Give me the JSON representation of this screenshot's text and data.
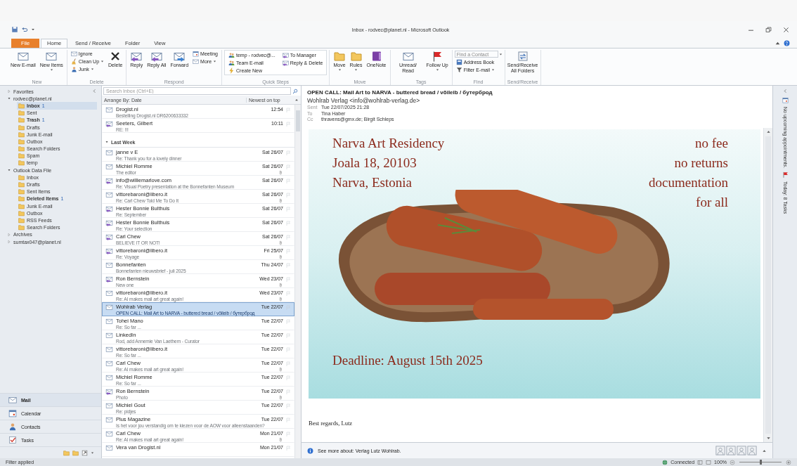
{
  "window": {
    "title": "Inbox - rodvec@planet.nl - Microsoft Outlook"
  },
  "ribbon": {
    "tabs": [
      {
        "label": "File",
        "kind": "file",
        "selected": false
      },
      {
        "label": "Home",
        "kind": "tab",
        "selected": true
      },
      {
        "label": "Send / Receive",
        "kind": "tab",
        "selected": false
      },
      {
        "label": "Folder",
        "kind": "tab",
        "selected": false
      },
      {
        "label": "View",
        "kind": "tab",
        "selected": false
      }
    ],
    "groups": [
      {
        "label": "New",
        "items": [
          {
            "label": "New E-mail",
            "kind": "large",
            "menu": false
          },
          {
            "label": "New Items",
            "kind": "large",
            "menu": true
          }
        ]
      },
      {
        "label": "Delete",
        "items": [
          {
            "label": "Ignore",
            "kind": "small",
            "menu": false
          },
          {
            "label": "Clean Up",
            "kind": "small",
            "menu": true
          },
          {
            "label": "Junk",
            "kind": "small",
            "menu": true
          },
          {
            "label": "Delete",
            "kind": "large",
            "menu": false
          }
        ]
      },
      {
        "label": "Respond",
        "items": [
          {
            "label": "Reply",
            "kind": "large",
            "menu": false
          },
          {
            "label": "Reply All",
            "kind": "large",
            "menu": false
          },
          {
            "label": "Forward",
            "kind": "large",
            "menu": false
          },
          {
            "label": "Meeting",
            "kind": "small",
            "menu": false
          },
          {
            "label": "More",
            "kind": "small",
            "menu": true
          }
        ]
      },
      {
        "label": "Quick Steps",
        "items": [
          {
            "label": "temp - rodvec@...",
            "kind": "quick"
          },
          {
            "label": "Team E-mail",
            "kind": "quick"
          },
          {
            "label": "Create New",
            "kind": "quick"
          },
          {
            "label": "To Manager",
            "kind": "quick"
          },
          {
            "label": "Reply & Delete",
            "kind": "quick"
          }
        ]
      },
      {
        "label": "Move",
        "items": [
          {
            "label": "Move",
            "kind": "large",
            "menu": true
          },
          {
            "label": "Rules",
            "kind": "large",
            "menu": true
          },
          {
            "label": "OneNote",
            "kind": "large",
            "menu": false
          }
        ]
      },
      {
        "label": "Tags",
        "items": [
          {
            "label": "Unread/ Read",
            "kind": "large",
            "menu": false
          },
          {
            "label": "Follow Up",
            "kind": "large",
            "menu": true
          }
        ]
      },
      {
        "label": "Find",
        "items": [
          {
            "placeholder": "Find a Contact",
            "kind": "field",
            "menu": true
          },
          {
            "label": "Address Book",
            "kind": "small",
            "menu": false
          },
          {
            "label": "Filter E-mail",
            "kind": "small",
            "menu": true
          }
        ]
      },
      {
        "label": "Send/Receive",
        "items": [
          {
            "label": "Send/Receive All Folders",
            "kind": "large",
            "menu": false
          }
        ]
      }
    ]
  },
  "folders": [
    {
      "label": "Favorites",
      "expanded": false,
      "selected": false
    },
    {
      "label": "rodvec@planet.nl",
      "expanded": true,
      "selected": false,
      "children": [
        {
          "label": "Inbox",
          "selected": true,
          "unread": true,
          "count": "1"
        },
        {
          "label": "Sent",
          "selected": false,
          "unread": false
        },
        {
          "label": "Trash",
          "selected": false,
          "unread": true,
          "count": "1"
        },
        {
          "label": "Drafts",
          "selected": false,
          "unread": false
        },
        {
          "label": "Junk E-mail",
          "selected": false,
          "unread": false
        },
        {
          "label": "Outbox",
          "selected": false,
          "unread": false
        },
        {
          "label": "Search Folders",
          "selected": false,
          "unread": false
        },
        {
          "label": "Spam",
          "selected": false,
          "unread": false
        },
        {
          "label": "temp",
          "selected": false,
          "unread": false
        }
      ]
    },
    {
      "label": "Outlook Data File",
      "expanded": true,
      "selected": false,
      "children": [
        {
          "label": "Inbox",
          "selected": false,
          "unread": false
        },
        {
          "label": "Drafts",
          "selected": false,
          "unread": false
        },
        {
          "label": "Sent Items",
          "selected": false,
          "unread": false
        },
        {
          "label": "Deleted Items",
          "selected": false,
          "unread": true,
          "count": "1"
        },
        {
          "label": "Junk E-mail",
          "selected": false,
          "unread": false
        },
        {
          "label": "Outbox",
          "selected": false,
          "unread": false
        },
        {
          "label": "RSS Feeds",
          "selected": false,
          "unread": false
        },
        {
          "label": "Search Folders",
          "selected": false,
          "unread": false
        }
      ]
    },
    {
      "label": "Archives",
      "expanded": false,
      "selected": false
    },
    {
      "label": "sumtax047@planet.nl",
      "expanded": false,
      "selected": false
    }
  ],
  "nav_buttons": [
    {
      "label": "Mail",
      "selected": true
    },
    {
      "label": "Calendar",
      "selected": false
    },
    {
      "label": "Contacts",
      "selected": false
    },
    {
      "label": "Tasks",
      "selected": false
    }
  ],
  "message_list": {
    "search": {
      "placeholder": "Search Inbox (Ctrl+E)"
    },
    "arrange": "Arrange By: Date",
    "order": "Newest on top",
    "groups": [
      {
        "rows": [
          {
            "sender": "Drogist.nl",
            "preview": "Bestelling Drogist.nl DR6200633332",
            "date": "12:54",
            "replied": false,
            "attachment": false,
            "selected": false
          },
          {
            "sender": "Seeters, Gilbert",
            "preview": "RE: !!!",
            "date": "10:11",
            "replied": true,
            "attachment": false,
            "selected": false
          }
        ]
      },
      {
        "label": "Last Week",
        "expanded": true,
        "rows": [
          {
            "sender": "janne v E",
            "preview": "Re: Thank you for a lovely dinner",
            "date": "Sat 26/07",
            "replied": false,
            "attachment": false,
            "selected": false
          },
          {
            "sender": "Michiel Romme",
            "preview": "The editor",
            "date": "Sat 26/07",
            "replied": false,
            "attachment": true,
            "selected": false
          },
          {
            "sender": "info@williemarlove.com",
            "preview": "Re: Visual Poetry presentation at the Bonnefanten Museum",
            "date": "Sat 26/07",
            "replied": true,
            "attachment": false,
            "selected": false
          },
          {
            "sender": "vittorebaroni@libero.it",
            "preview": "Re: Carl Chew Told Me To Do It",
            "date": "Sat 26/07",
            "replied": false,
            "attachment": true,
            "selected": false
          },
          {
            "sender": "Hester Bonnie Bulthuis",
            "preview": "Re: September",
            "date": "Sat 26/07",
            "replied": true,
            "attachment": false,
            "selected": false
          },
          {
            "sender": "Hester Bonnie Bulthuis",
            "preview": "Re: Your selection",
            "date": "Sat 26/07",
            "replied": true,
            "attachment": false,
            "selected": false
          },
          {
            "sender": "Carl Chew",
            "preview": "BELIEVE IT OR NOT!",
            "date": "Sat 26/07",
            "replied": true,
            "attachment": true,
            "selected": false
          },
          {
            "sender": "vittorebaroni@libero.it",
            "preview": "Re: Voyage",
            "date": "Fri 25/07",
            "replied": true,
            "attachment": true,
            "selected": false
          },
          {
            "sender": "Bonnefanten",
            "preview": "Bonnefanten nieuwsbrief - juli 2025",
            "date": "Thu 24/07",
            "replied": false,
            "attachment": false,
            "selected": false
          },
          {
            "sender": "Ron Bernstein",
            "preview": "New one",
            "date": "Wed 23/07",
            "replied": true,
            "attachment": true,
            "selected": false
          },
          {
            "sender": "vittorebaroni@libero.it",
            "preview": "Re: AI makes mail art great again!",
            "date": "Wed 23/07",
            "replied": false,
            "attachment": true,
            "selected": false
          },
          {
            "sender": "Wohlrab Verlag",
            "preview": "OPEN CALL: Mail Art to NARVA - buttered bread / võileib / бутерброд",
            "date": "Tue 22/07",
            "replied": false,
            "attachment": false,
            "selected": true
          },
          {
            "sender": "Tohei Mano",
            "preview": "Re: So far ...",
            "date": "Tue 22/07",
            "replied": false,
            "attachment": false,
            "selected": false
          },
          {
            "sender": "LinkedIn",
            "preview": "Rod, add Annemie Van Laethem - Curator",
            "date": "Tue 22/07",
            "replied": false,
            "attachment": false,
            "selected": false
          },
          {
            "sender": "vittorebaroni@libero.it",
            "preview": "Re: So far ...",
            "date": "Tue 22/07",
            "replied": false,
            "attachment": false,
            "selected": false
          },
          {
            "sender": "Carl Chew",
            "preview": "Re: AI makes mail art great again!",
            "date": "Tue 22/07",
            "replied": false,
            "attachment": true,
            "selected": false
          },
          {
            "sender": "Michiel Romme",
            "preview": "Re: So far ...",
            "date": "Tue 22/07",
            "replied": false,
            "attachment": false,
            "selected": false
          },
          {
            "sender": "Ron Bernstein",
            "preview": "Photo",
            "date": "Tue 22/07",
            "replied": true,
            "attachment": true,
            "selected": false
          },
          {
            "sender": "Michiel Gout",
            "preview": "Re: pidjes",
            "date": "Tue 22/07",
            "replied": false,
            "attachment": false,
            "selected": false
          },
          {
            "sender": "Plus Magazine",
            "preview": "Is het voor jou verstandig om te kiezen voor de AOW voor alleenstaanden?",
            "date": "Tue 22/07",
            "replied": false,
            "attachment": false,
            "selected": false
          },
          {
            "sender": "Carl Chew",
            "preview": "Re: AI makes mail art great again!",
            "date": "Mon 21/07",
            "replied": false,
            "attachment": true,
            "selected": false
          },
          {
            "sender": "Vera van Drogist.nl",
            "date": "Mon 21/07",
            "replied": false,
            "attachment": false,
            "selected": false
          }
        ]
      }
    ]
  },
  "reading_pane": {
    "subject": "OPEN CALL: Mail Art to NARVA - buttered bread / võileib / бутерброд",
    "from": "Wohlrab Verlag <info@wohlrab-verlag.de>",
    "fields": [
      {
        "label": "Sent",
        "value": "Tue 22/07/2025 21:28"
      },
      {
        "label": "To",
        "value": "Tina Haber"
      },
      {
        "label": "Cc",
        "value": "thravens@gmx.de; Birgit Schleps"
      }
    ],
    "poster": {
      "left": [
        "Narva Art Residency",
        "Joala 18, 20103",
        "Narva, Estonia"
      ],
      "right": [
        "no fee",
        "no returns",
        "documentation",
        "for all"
      ],
      "deadline": "Deadline: August 15th 2025"
    },
    "signature": "Best regards, Lutz",
    "people_pane": "See more about: Verlag Lutz Wohlrab."
  },
  "todo_bar": {
    "appointments": "No upcoming appointments.",
    "tasks": "Today: 8 Tasks"
  },
  "status_bar": {
    "left": "Filter applied",
    "connection": "Connected",
    "zoom": "100%",
    "zoom_slider": {
      "level": 0.5
    }
  }
}
